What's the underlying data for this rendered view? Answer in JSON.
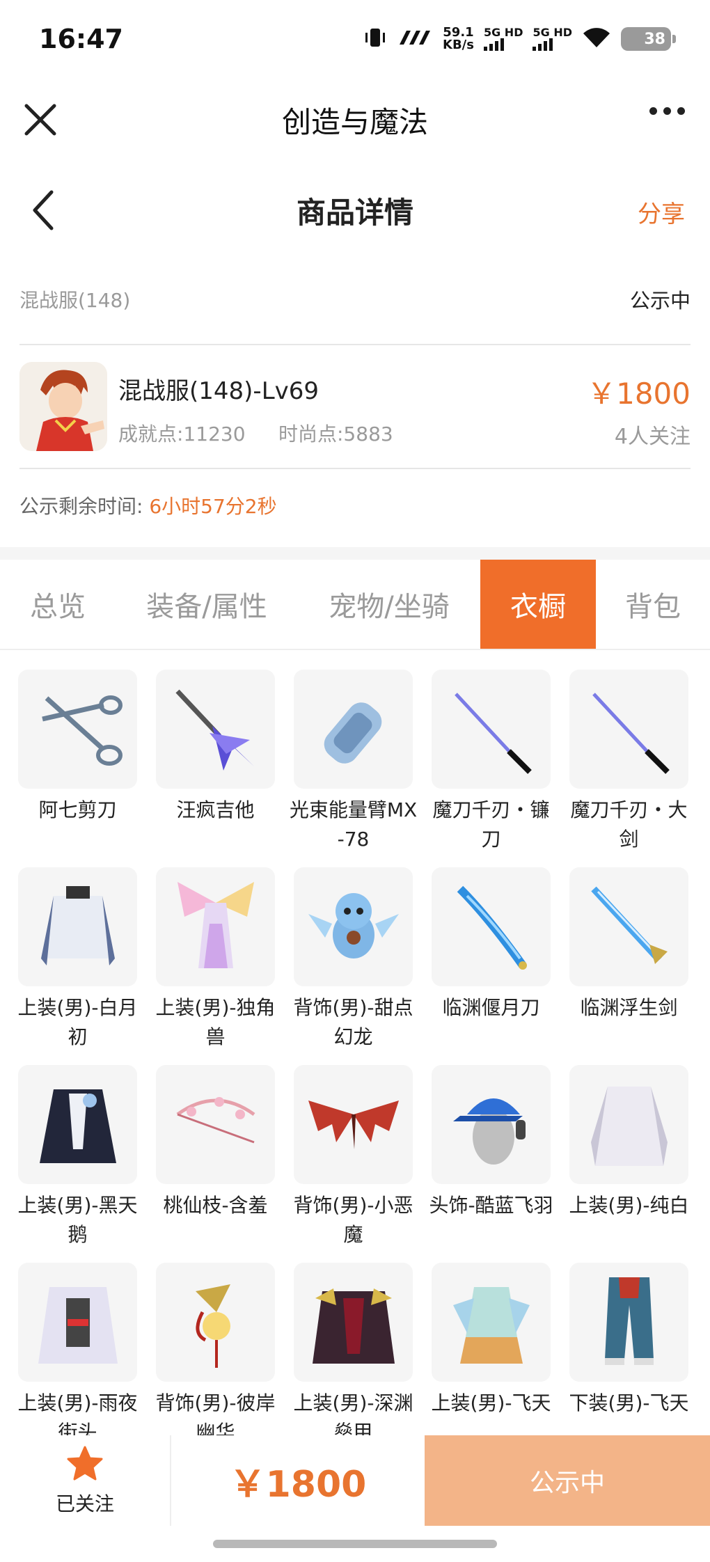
{
  "status_bar": {
    "time": "16:47",
    "net_speed_value": "59.1",
    "net_speed_unit": "KB/s",
    "signal1_label": "5G HD",
    "signal2_label": "5G HD",
    "battery": "38"
  },
  "miniprogram": {
    "title": "创造与魔法"
  },
  "nav": {
    "title": "商品详情",
    "share_label": "分享"
  },
  "server": {
    "name": "混战服(148)",
    "status": "公示中"
  },
  "product": {
    "name": "混战服(148)-Lv69",
    "achievement": "成就点:11230",
    "fashion": "时尚点:5883",
    "price": "￥1800",
    "followers": "4人关注"
  },
  "countdown": {
    "label": "公示剩余时间: ",
    "value": "6小时57分2秒"
  },
  "tabs": [
    {
      "label": "总览",
      "active": false
    },
    {
      "label": "装备/属性",
      "active": false
    },
    {
      "label": "宠物/坐骑",
      "active": false
    },
    {
      "label": "衣橱",
      "active": true
    },
    {
      "label": "背包",
      "active": false
    }
  ],
  "wardrobe_items": [
    {
      "label": "阿七剪刀",
      "icon": "scissors-icon"
    },
    {
      "label": "汪疯吉他",
      "icon": "guitar-icon"
    },
    {
      "label": "光束能量臂MX-78",
      "icon": "energy-arm-icon"
    },
    {
      "label": "魔刀千刃・镰刀",
      "icon": "katana-icon"
    },
    {
      "label": "魔刀千刃・大剑",
      "icon": "katana-icon"
    },
    {
      "label": "上装(男)-白月初",
      "icon": "white-robe-icon"
    },
    {
      "label": "上装(男)-独角兽",
      "icon": "unicorn-outfit-icon"
    },
    {
      "label": "背饰(男)-甜点幻龙",
      "icon": "baby-dragon-icon"
    },
    {
      "label": "临渊偃月刀",
      "icon": "ice-glaive-icon"
    },
    {
      "label": "临渊浮生剑",
      "icon": "ice-sword-icon"
    },
    {
      "label": "上装(男)-黑天鹅",
      "icon": "black-swan-coat-icon"
    },
    {
      "label": "桃仙枝-含羞",
      "icon": "blossom-bow-icon"
    },
    {
      "label": "背饰(男)-小恶魔",
      "icon": "demon-wings-icon"
    },
    {
      "label": "头饰-酷蓝飞羽",
      "icon": "blue-cap-icon"
    },
    {
      "label": "上装(男)-纯白",
      "icon": "pure-white-coat-icon"
    },
    {
      "label": "上装(男)-雨夜街头",
      "icon": "street-jacket-icon"
    },
    {
      "label": "背饰(男)-彼岸幽华",
      "icon": "fan-charm-icon"
    },
    {
      "label": "上装(男)-深渊燊甲",
      "icon": "abyss-armor-icon"
    },
    {
      "label": "上装(男)-飞天",
      "icon": "feitian-top-icon"
    },
    {
      "label": "下装(男)-飞天",
      "icon": "feitian-pants-icon"
    }
  ],
  "bottom_bar": {
    "follow_label": "已关注",
    "price": "￥1800",
    "status_button": "公示中"
  },
  "colors": {
    "accent": "#f06e2a",
    "price": "#e8742f",
    "status_button": "#f3b488"
  }
}
